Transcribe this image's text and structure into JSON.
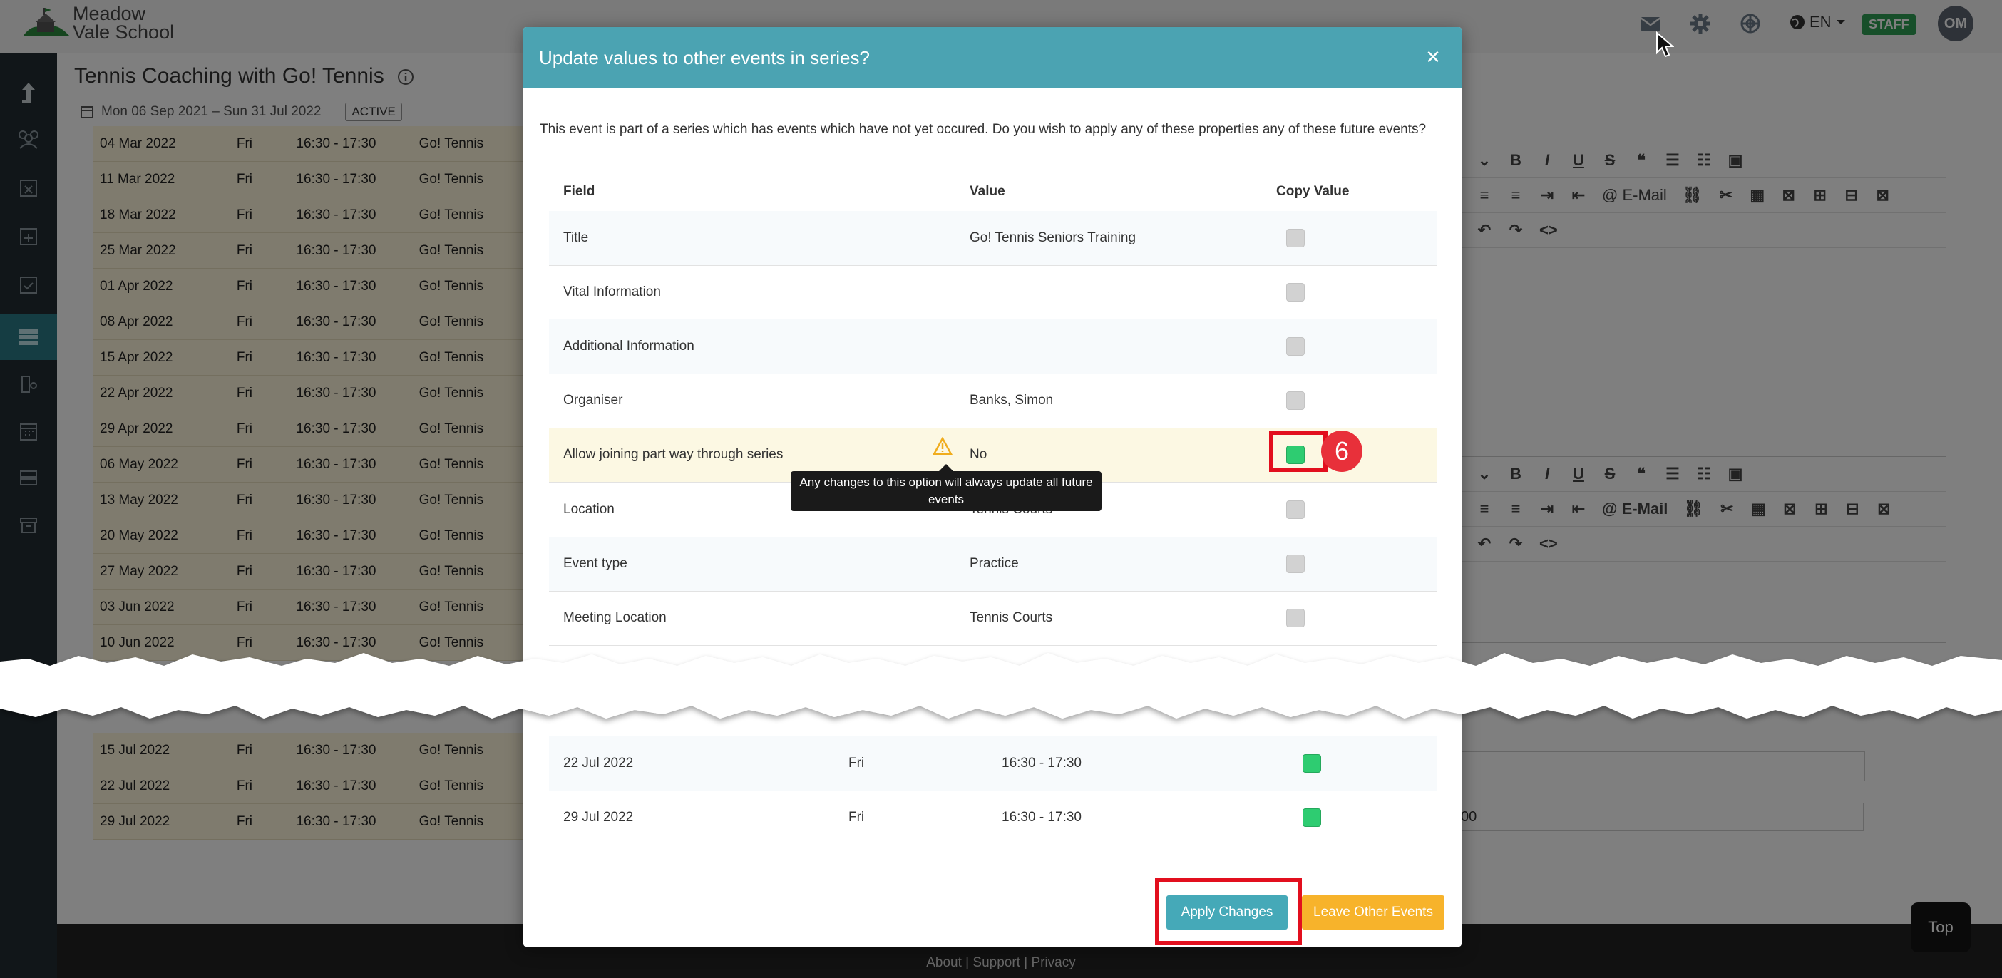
{
  "brand": {
    "line1": "Meadow",
    "line2": "Vale School"
  },
  "topbar": {
    "language": "EN",
    "staff_badge": "STAFF",
    "avatar_initials": "OM"
  },
  "page": {
    "title": "Tennis Coaching with Go! Tennis",
    "date_range": "Mon 06 Sep 2021 – Sun 31 Jul 2022",
    "status": "ACTIVE",
    "editor_email_label": "@ E-Mail",
    "input_value": "00"
  },
  "background_rows": [
    {
      "date": "04 Mar 2022",
      "day": "Fri",
      "time": "16:30 - 17:30",
      "provider": "Go! Tennis"
    },
    {
      "date": "11 Mar 2022",
      "day": "Fri",
      "time": "16:30 - 17:30",
      "provider": "Go! Tennis"
    },
    {
      "date": "18 Mar 2022",
      "day": "Fri",
      "time": "16:30 - 17:30",
      "provider": "Go! Tennis"
    },
    {
      "date": "25 Mar 2022",
      "day": "Fri",
      "time": "16:30 - 17:30",
      "provider": "Go! Tennis"
    },
    {
      "date": "01 Apr 2022",
      "day": "Fri",
      "time": "16:30 - 17:30",
      "provider": "Go! Tennis"
    },
    {
      "date": "08 Apr 2022",
      "day": "Fri",
      "time": "16:30 - 17:30",
      "provider": "Go! Tennis"
    },
    {
      "date": "15 Apr 2022",
      "day": "Fri",
      "time": "16:30 - 17:30",
      "provider": "Go! Tennis"
    },
    {
      "date": "22 Apr 2022",
      "day": "Fri",
      "time": "16:30 - 17:30",
      "provider": "Go! Tennis"
    },
    {
      "date": "29 Apr 2022",
      "day": "Fri",
      "time": "16:30 - 17:30",
      "provider": "Go! Tennis"
    },
    {
      "date": "06 May 2022",
      "day": "Fri",
      "time": "16:30 - 17:30",
      "provider": "Go! Tennis"
    },
    {
      "date": "13 May 2022",
      "day": "Fri",
      "time": "16:30 - 17:30",
      "provider": "Go! Tennis"
    },
    {
      "date": "20 May 2022",
      "day": "Fri",
      "time": "16:30 - 17:30",
      "provider": "Go! Tennis"
    },
    {
      "date": "27 May 2022",
      "day": "Fri",
      "time": "16:30 - 17:30",
      "provider": "Go! Tennis"
    },
    {
      "date": "03 Jun 2022",
      "day": "Fri",
      "time": "16:30 - 17:30",
      "provider": "Go! Tennis"
    },
    {
      "date": "10 Jun 2022",
      "day": "Fri",
      "time": "16:30 - 17:30",
      "provider": "Go! Tennis"
    }
  ],
  "background_rows_bottom": [
    {
      "date": "15 Jul 2022",
      "day": "Fri",
      "time": "16:30 - 17:30",
      "provider": "Go! Tennis"
    },
    {
      "date": "22 Jul 2022",
      "day": "Fri",
      "time": "16:30 - 17:30",
      "provider": "Go! Tennis"
    },
    {
      "date": "29 Jul 2022",
      "day": "Fri",
      "time": "16:30 - 17:30",
      "provider": "Go! Tennis"
    }
  ],
  "modal": {
    "title": "Update values to other events in series?",
    "close_symbol": "×",
    "intro": "This event is part of a series which has events which have not yet occured. Do you wish to apply any of these properties any of these future events?",
    "columns": {
      "field": "Field",
      "value": "Value",
      "copy": "Copy Value"
    },
    "rows": [
      {
        "field": "Title",
        "value": "Go! Tennis Seniors Training",
        "checked": false
      },
      {
        "field": "Vital Information",
        "value": "",
        "checked": false
      },
      {
        "field": "Additional Information",
        "value": "",
        "checked": false
      },
      {
        "field": "Organiser",
        "value": "Banks, Simon",
        "checked": false
      },
      {
        "field": "Allow joining part way through series",
        "value": "No",
        "checked": true
      },
      {
        "field": "Location",
        "value": "Tennis Courts",
        "checked": false
      },
      {
        "field": "Event type",
        "value": "Practice",
        "checked": false
      },
      {
        "field": "Meeting Location",
        "value": "Tennis Courts",
        "checked": false
      }
    ],
    "tooltip": "Any changes to this option will always update all future events",
    "event_rows": [
      {
        "date": "22 Jul 2022",
        "day": "Fri",
        "time": "16:30 - 17:30",
        "checked": true
      },
      {
        "date": "29 Jul 2022",
        "day": "Fri",
        "time": "16:30 - 17:30",
        "checked": true
      }
    ],
    "apply_label": "Apply Changes",
    "leave_label": "Leave Other Events"
  },
  "annotation": {
    "step_number": "6"
  },
  "footer": {
    "about": "About",
    "support": "Support",
    "privacy": "Privacy",
    "separator": " | ",
    "top_label": "Top"
  },
  "icons": [
    "mail-icon",
    "gear-icon",
    "globe-icon",
    "language-globe-icon",
    "upload-icon",
    "users-icon",
    "calendar-x-icon",
    "calendar-plus-icon",
    "calendar-check-icon",
    "table-icon",
    "calendar-icon",
    "archive-icon",
    "info-icon",
    "warning-icon",
    "close-icon"
  ],
  "colors": {
    "modal_header": "#4ba3b2",
    "apply": "#45a9b8",
    "leave": "#f7b32b",
    "checkbox_on": "#2ecc71",
    "annotation_red": "#e20f1e",
    "staff_badge": "#2e9e55"
  }
}
